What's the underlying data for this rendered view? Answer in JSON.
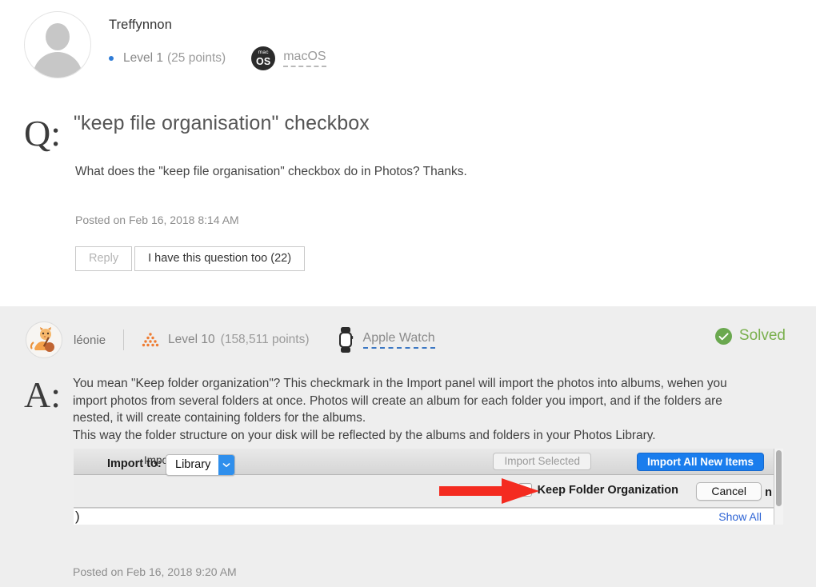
{
  "question": {
    "author": "Treffynnon",
    "level": "Level 1",
    "points": "(25 points)",
    "product_badge": {
      "icon_top": "mac",
      "icon_bottom": "OS",
      "label": "macOS"
    },
    "marker": "Q:",
    "title": "\"keep file organisation\" checkbox",
    "body": "What does the \"keep file organisation\" checkbox do in Photos? Thanks.",
    "posted": "Posted on Feb 16, 2018 8:14 AM",
    "reply_button": "Reply",
    "me_too_button": "I have this question too (22)"
  },
  "answer": {
    "author": "léonie",
    "level": "Level 10",
    "points": "(158,511 points)",
    "product_badge": {
      "label": "Apple Watch"
    },
    "status": "Solved",
    "marker": "A:",
    "body_line1": "You mean \"Keep folder organization\"? This checkmark in the Import panel will import the photos into albums, wehen you",
    "body_line2": "import photos from several folders at once.  Photos will create an album for each folder you import, and if the folders are",
    "body_line3": "nested, it will create containing folders for the albums.",
    "body_line4": "This way the folder structure on your disk will be reflected by the albums and folders in your Photos Library.",
    "posted": "Posted on Feb 16, 2018 9:20 AM"
  },
  "embedded_screenshot": {
    "window_title": "Import",
    "import_to_label": "Import to:",
    "import_to_value": "Library",
    "import_selected_button": "Import Selected",
    "import_all_button": "Import All New Items",
    "keep_folder_checkbox_label": "Keep Folder Organization",
    "keep_folder_checked": false,
    "cancel_button": "Cancel",
    "bottom_left_text": ")",
    "show_all_link": "Show All",
    "clipped_letter": "n"
  },
  "colors": {
    "accent_blue": "#1a7ded",
    "solved_green": "#7ab04e",
    "level_orange": "#ee7c32",
    "arrow_red": "#f42b20",
    "link_blue": "#2d63d4",
    "answer_bg": "#eeeeee"
  }
}
